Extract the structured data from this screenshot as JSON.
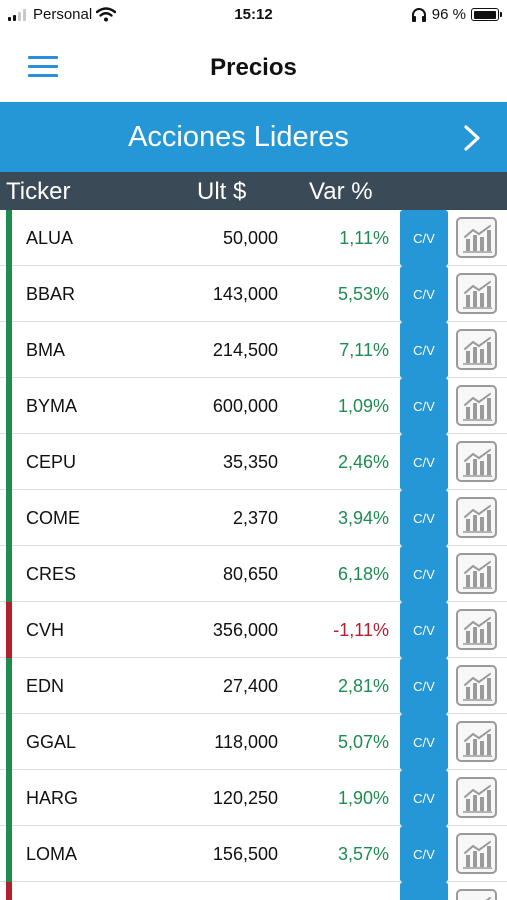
{
  "status_bar": {
    "carrier": "Personal",
    "time": "15:12",
    "battery": "96 %",
    "battery_level": 0.96
  },
  "header": {
    "title": "Precios"
  },
  "category": {
    "title": "Acciones Lideres"
  },
  "columns": {
    "ticker": "Ticker",
    "last": "Ult $",
    "change": "Var %"
  },
  "colors": {
    "accent": "#2597d6",
    "header_bg": "#3a4a56",
    "up": "#1e8c4e",
    "down": "#b51e2d"
  },
  "icons": {
    "menu": "hamburger-icon",
    "next": "chevron-right-icon",
    "chart": "chart-icon",
    "wifi": "wifi-icon",
    "headphones": "headphones-icon",
    "battery": "battery-icon"
  },
  "rows": [
    {
      "ticker": "ALUA",
      "price": "50,000",
      "change": "1,11%",
      "direction": "up",
      "cv_label": "C/V"
    },
    {
      "ticker": "BBAR",
      "price": "143,000",
      "change": "5,53%",
      "direction": "up",
      "cv_label": "C/V"
    },
    {
      "ticker": "BMA",
      "price": "214,500",
      "change": "7,11%",
      "direction": "up",
      "cv_label": "C/V"
    },
    {
      "ticker": "BYMA",
      "price": "600,000",
      "change": "1,09%",
      "direction": "up",
      "cv_label": "C/V"
    },
    {
      "ticker": "CEPU",
      "price": "35,350",
      "change": "2,46%",
      "direction": "up",
      "cv_label": "C/V"
    },
    {
      "ticker": "COME",
      "price": "2,370",
      "change": "3,94%",
      "direction": "up",
      "cv_label": "C/V"
    },
    {
      "ticker": "CRES",
      "price": "80,650",
      "change": "6,18%",
      "direction": "up",
      "cv_label": "C/V"
    },
    {
      "ticker": "CVH",
      "price": "356,000",
      "change": "-1,11%",
      "direction": "down",
      "cv_label": "C/V"
    },
    {
      "ticker": "EDN",
      "price": "27,400",
      "change": "2,81%",
      "direction": "up",
      "cv_label": "C/V"
    },
    {
      "ticker": "GGAL",
      "price": "118,000",
      "change": "5,07%",
      "direction": "up",
      "cv_label": "C/V"
    },
    {
      "ticker": "HARG",
      "price": "120,250",
      "change": "1,90%",
      "direction": "up",
      "cv_label": "C/V"
    },
    {
      "ticker": "LOMA",
      "price": "156,500",
      "change": "3,57%",
      "direction": "up",
      "cv_label": "C/V"
    },
    {
      "ticker": "",
      "price": "",
      "change": "",
      "direction": "down",
      "cv_label": ""
    }
  ]
}
